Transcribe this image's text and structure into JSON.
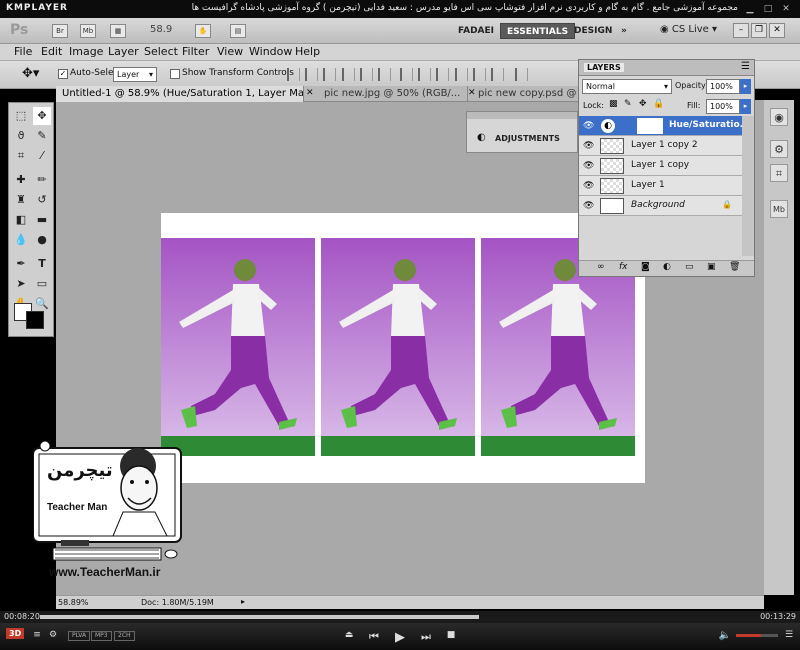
{
  "kmplayer": {
    "logo": "KMPLAYER",
    "caption": "مجموعه آموزشی جامع . گام به گام و کاربردی نرم افزار فتوشاپ سی اس فایو   مدرس : سعید فدایی (تیچرمن ) گروه آموزشی پادشاه گرافیست ها",
    "time_elapsed": "00:08:20",
    "time_total": "00:13:29",
    "progress": 0.61,
    "volume": 0.6,
    "badges": [
      "3D",
      "PLVA",
      "MP3",
      "2CH"
    ]
  },
  "app": {
    "logo": "Ps",
    "icons": [
      "Br",
      "Mb"
    ],
    "zoom": "58.9",
    "workspaces": [
      "FADAEI",
      "ESSENTIALS",
      "DESIGN"
    ],
    "active_workspace": "ESSENTIALS",
    "cs_live": "CS Live"
  },
  "menu": [
    "File",
    "Edit",
    "Image",
    "Layer",
    "Select",
    "Filter",
    "View",
    "Window",
    "Help"
  ],
  "options": {
    "auto_select_label": "Auto-Select:",
    "auto_select_value": "Layer",
    "transform_label": "Show Transform Controls"
  },
  "tabs": [
    "Untitled-1 @ 58.9% (Hue/Saturation 1, Layer Mask/8)",
    "pic new.jpg @ 50% (RGB/...",
    "pic new copy.psd @ 50..."
  ],
  "adjustments": {
    "title": "ADJUSTMENTS"
  },
  "layers_panel": {
    "title": "LAYERS",
    "blend_mode": "Normal",
    "opacity_label": "Opacity:",
    "opacity": "100%",
    "lock_label": "Lock:",
    "fill_label": "Fill:",
    "fill": "100%",
    "layers": [
      {
        "name": "Hue/Saturatio...",
        "selected": true
      },
      {
        "name": "Layer 1 copy 2",
        "selected": false
      },
      {
        "name": "Layer 1 copy",
        "selected": false
      },
      {
        "name": "Layer 1",
        "selected": false
      },
      {
        "name": "Background",
        "selected": false
      }
    ]
  },
  "status": {
    "zoom": "58.89%",
    "doc": "Doc: 1.80M/5.19M"
  },
  "watermark": {
    "site": "www.TeacherMan.ir",
    "brand": "Teacher Man"
  }
}
